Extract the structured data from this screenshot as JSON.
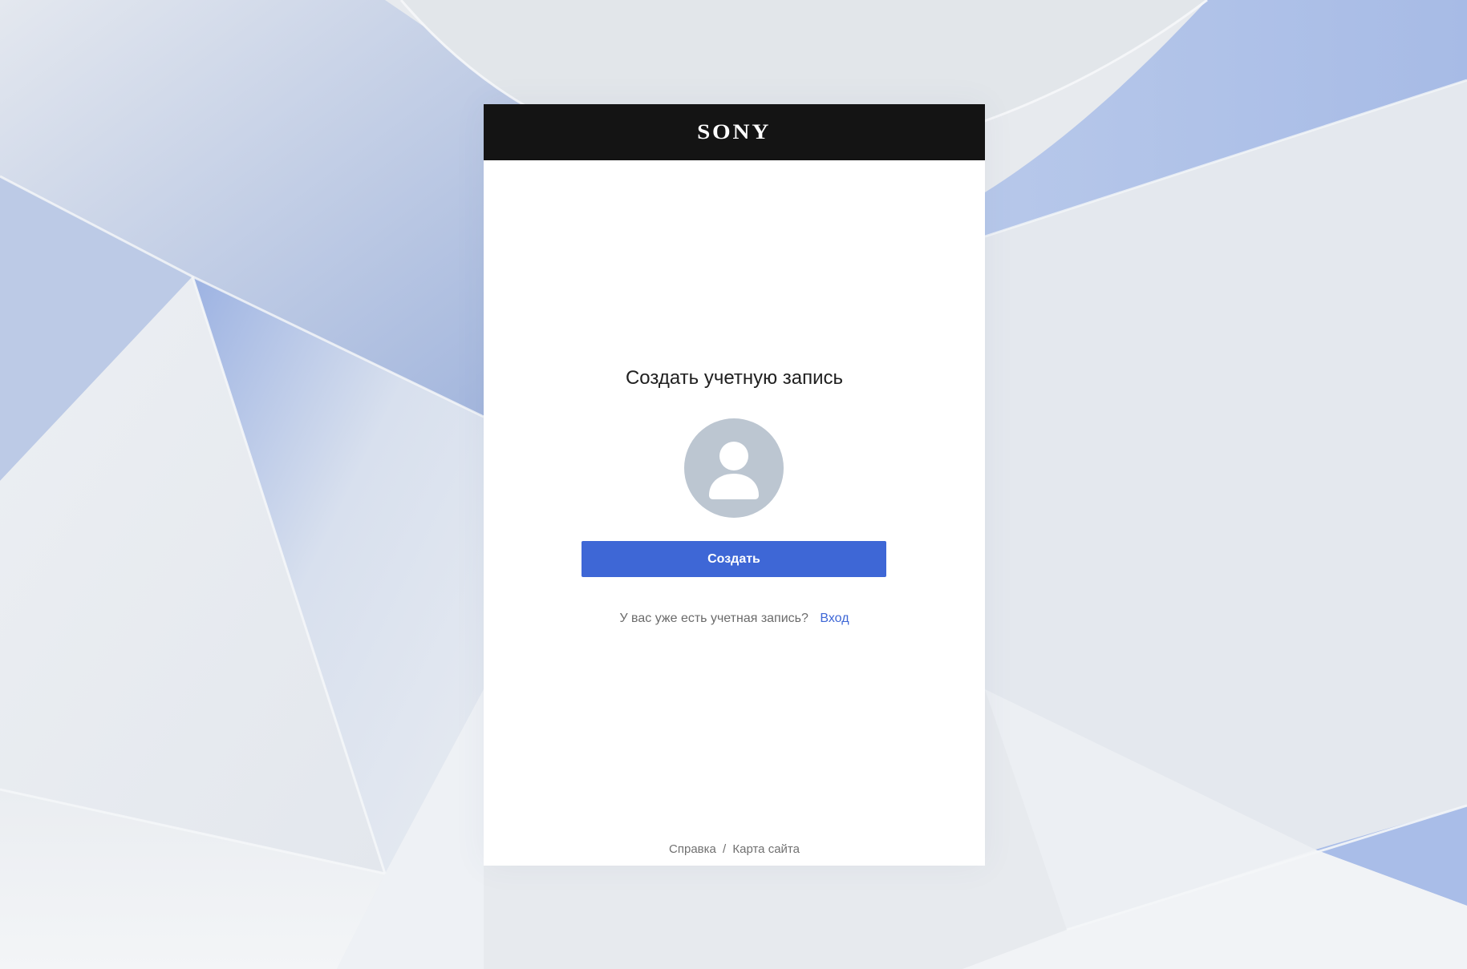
{
  "header": {
    "logo_text": "SONY"
  },
  "main": {
    "title": "Создать учетную запись",
    "avatar_icon": "user-silhouette-icon",
    "create_button_label": "Создать",
    "signin_prompt": "У вас уже есть учетная запись?",
    "signin_link_label": "Вход"
  },
  "footer": {
    "help_link_label": "Справка",
    "separator": "/",
    "sitemap_link_label": "Карта сайта"
  },
  "colors": {
    "header_background": "#141414",
    "accent": "#3e67d6",
    "avatar_background": "#bcc6d1",
    "page_background": "#e6eaef"
  }
}
